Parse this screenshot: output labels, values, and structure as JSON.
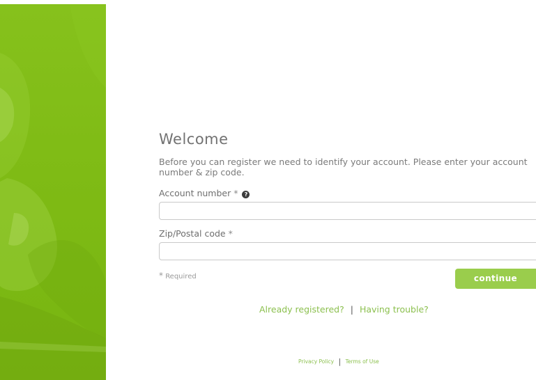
{
  "welcome": {
    "title": "Welcome",
    "intro": "Before you can register we need to identify your account. Please enter your account number & zip code."
  },
  "form": {
    "account_label": "Account number",
    "account_required_mark": "*",
    "account_help_icon": "question-circle-icon",
    "account_value": "",
    "zip_label": "Zip/Postal code",
    "zip_required_mark": "*",
    "zip_value": "",
    "required_mark": "*",
    "required_note": "Required",
    "continue_label": "continue"
  },
  "links": {
    "already_registered": "Already registered?",
    "separator": "|",
    "having_trouble": "Having trouble?"
  },
  "footer": {
    "privacy": "Privacy Policy",
    "separator": "|",
    "terms": "Terms of Use"
  },
  "colors": {
    "brand_green": "#7fbb15",
    "button_green": "#9acd4c",
    "link_green": "#8cc04f"
  }
}
